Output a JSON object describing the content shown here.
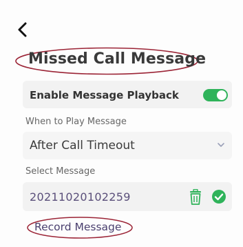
{
  "header": {
    "back_icon": "chevron-left-icon",
    "title": "Missed Call Message"
  },
  "playback": {
    "label": "Enable Message Playback",
    "enabled": true,
    "toggle_color": "#2fb35a"
  },
  "when": {
    "section_label": "When to Play Message",
    "selected": "After Call Timeout"
  },
  "select": {
    "section_label": "Select Message",
    "message_name": "20211020102259",
    "delete_icon": "trash-icon",
    "selected_icon": "check-circle-icon"
  },
  "record": {
    "label": "Record Message"
  },
  "colors": {
    "annotation": "#9b2335",
    "accent_green": "#2fb35a"
  }
}
